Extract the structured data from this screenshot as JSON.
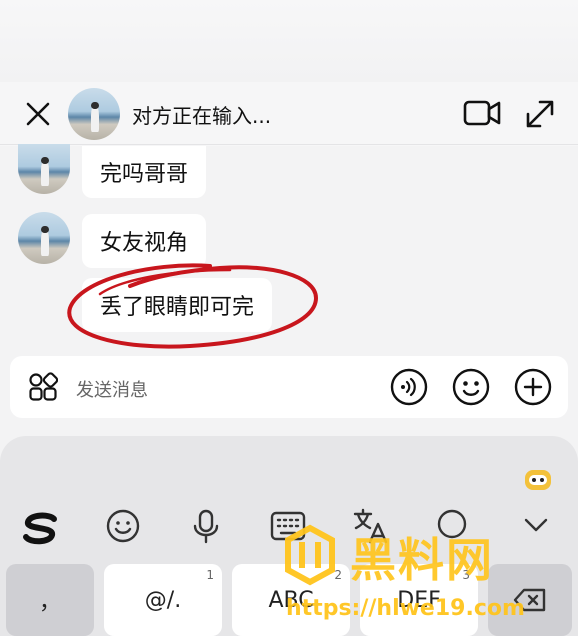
{
  "header": {
    "title": "对方正在输入..."
  },
  "messages": [
    {
      "text": "完吗哥哥"
    },
    {
      "text": "女友视角"
    },
    {
      "text": "丢了眼睛即可完"
    }
  ],
  "input": {
    "placeholder": "发送消息"
  },
  "keyboard": {
    "keys": [
      {
        "label": "，",
        "num": ""
      },
      {
        "label": "@/.",
        "num": "1"
      },
      {
        "label": "ABC",
        "num": "2"
      },
      {
        "label": "DEF",
        "num": "3"
      }
    ]
  },
  "watermark": {
    "text": "黑料网",
    "url": "https://hlwe19.com"
  },
  "colors": {
    "annotation_circle": "#c8161d",
    "watermark": "#ffc41c"
  },
  "icons": [
    "close-icon",
    "video-call-icon",
    "expand-icon",
    "apps-grid-icon",
    "voice-icon",
    "emoji-icon",
    "plus-icon",
    "sogou-logo-icon",
    "emoji-keyboard-icon",
    "mic-icon",
    "keyboard-icon",
    "translate-icon",
    "search-icon",
    "collapse-keyboard-icon",
    "delete-icon"
  ]
}
